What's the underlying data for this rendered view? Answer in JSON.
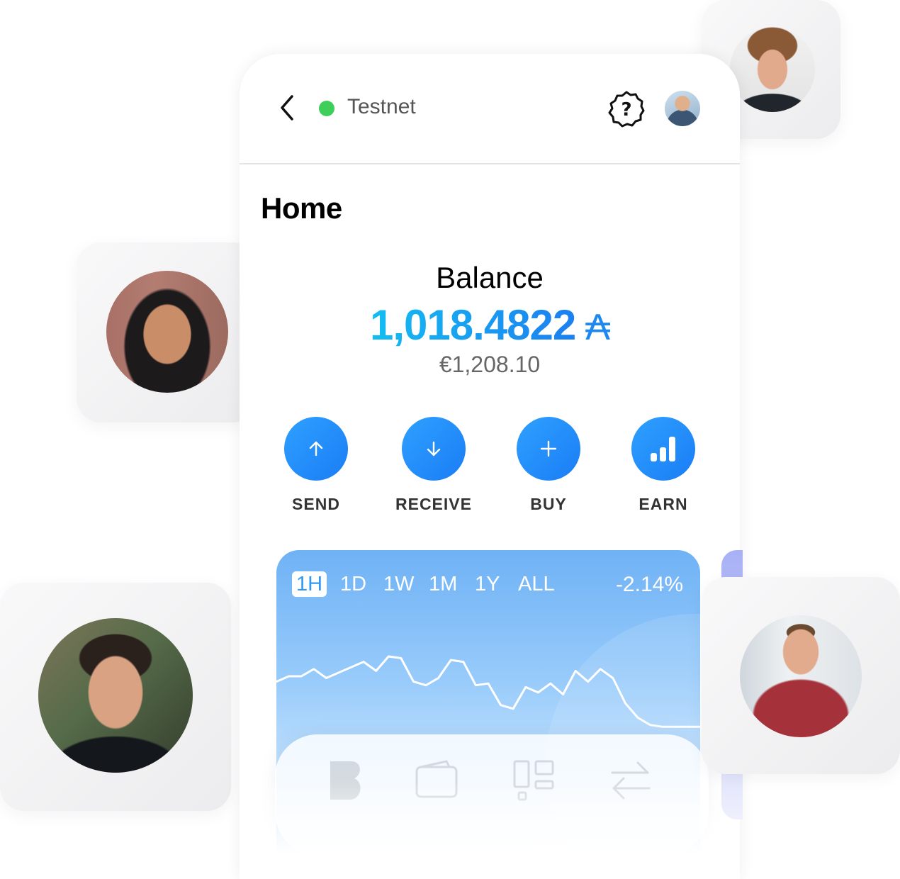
{
  "header": {
    "back_icon": "chevron-left-icon",
    "network_label": "Testnet",
    "network_status_color": "#3ecf5a",
    "help_icon": "question-badge-icon"
  },
  "page": {
    "title": "Home"
  },
  "balance": {
    "label": "Balance",
    "amount": "1,018.4822",
    "currency_symbol": "₳",
    "fiat": "€1,208.10",
    "accent_color": "#1aaaf0"
  },
  "actions": [
    {
      "label": "SEND",
      "icon": "arrow-up-icon"
    },
    {
      "label": "RECEIVE",
      "icon": "arrow-down-icon"
    },
    {
      "label": "BUY",
      "icon": "plus-icon"
    },
    {
      "label": "EARN",
      "icon": "bars-chart-icon"
    }
  ],
  "chart": {
    "ranges": [
      "1H",
      "1D",
      "1W",
      "1M",
      "1Y",
      "ALL"
    ],
    "active_range": "1H",
    "change": "-2.14%"
  },
  "chart_data": {
    "type": "line",
    "title": "",
    "xlabel": "",
    "ylabel": "",
    "x": [
      0,
      1,
      2,
      3,
      4,
      5,
      6,
      7,
      8,
      9,
      10,
      11,
      12,
      13,
      14,
      15,
      16,
      17,
      18,
      19,
      20,
      21,
      22,
      23,
      24,
      25,
      26,
      27,
      28,
      29,
      30,
      31,
      32,
      33,
      34
    ],
    "values": [
      0.6,
      0.66,
      0.66,
      0.74,
      0.64,
      0.7,
      0.76,
      0.82,
      0.72,
      0.88,
      0.86,
      0.6,
      0.56,
      0.64,
      0.84,
      0.82,
      0.56,
      0.58,
      0.34,
      0.3,
      0.54,
      0.48,
      0.58,
      0.46,
      0.72,
      0.6,
      0.74,
      0.64,
      0.36,
      0.2,
      0.12,
      0.1,
      0.1,
      0.1,
      0.1
    ],
    "series_hidden_behind_nav": true
  },
  "bottom_nav": {
    "items": [
      {
        "icon": "brand-logo-icon"
      },
      {
        "icon": "wallet-icon"
      },
      {
        "icon": "dashboard-icon"
      },
      {
        "icon": "transfer-arrows-icon"
      }
    ]
  },
  "people": [
    {
      "icon": "avatar-photo-icon"
    },
    {
      "icon": "avatar-photo-icon"
    },
    {
      "icon": "avatar-photo-icon"
    },
    {
      "icon": "avatar-photo-icon"
    }
  ]
}
